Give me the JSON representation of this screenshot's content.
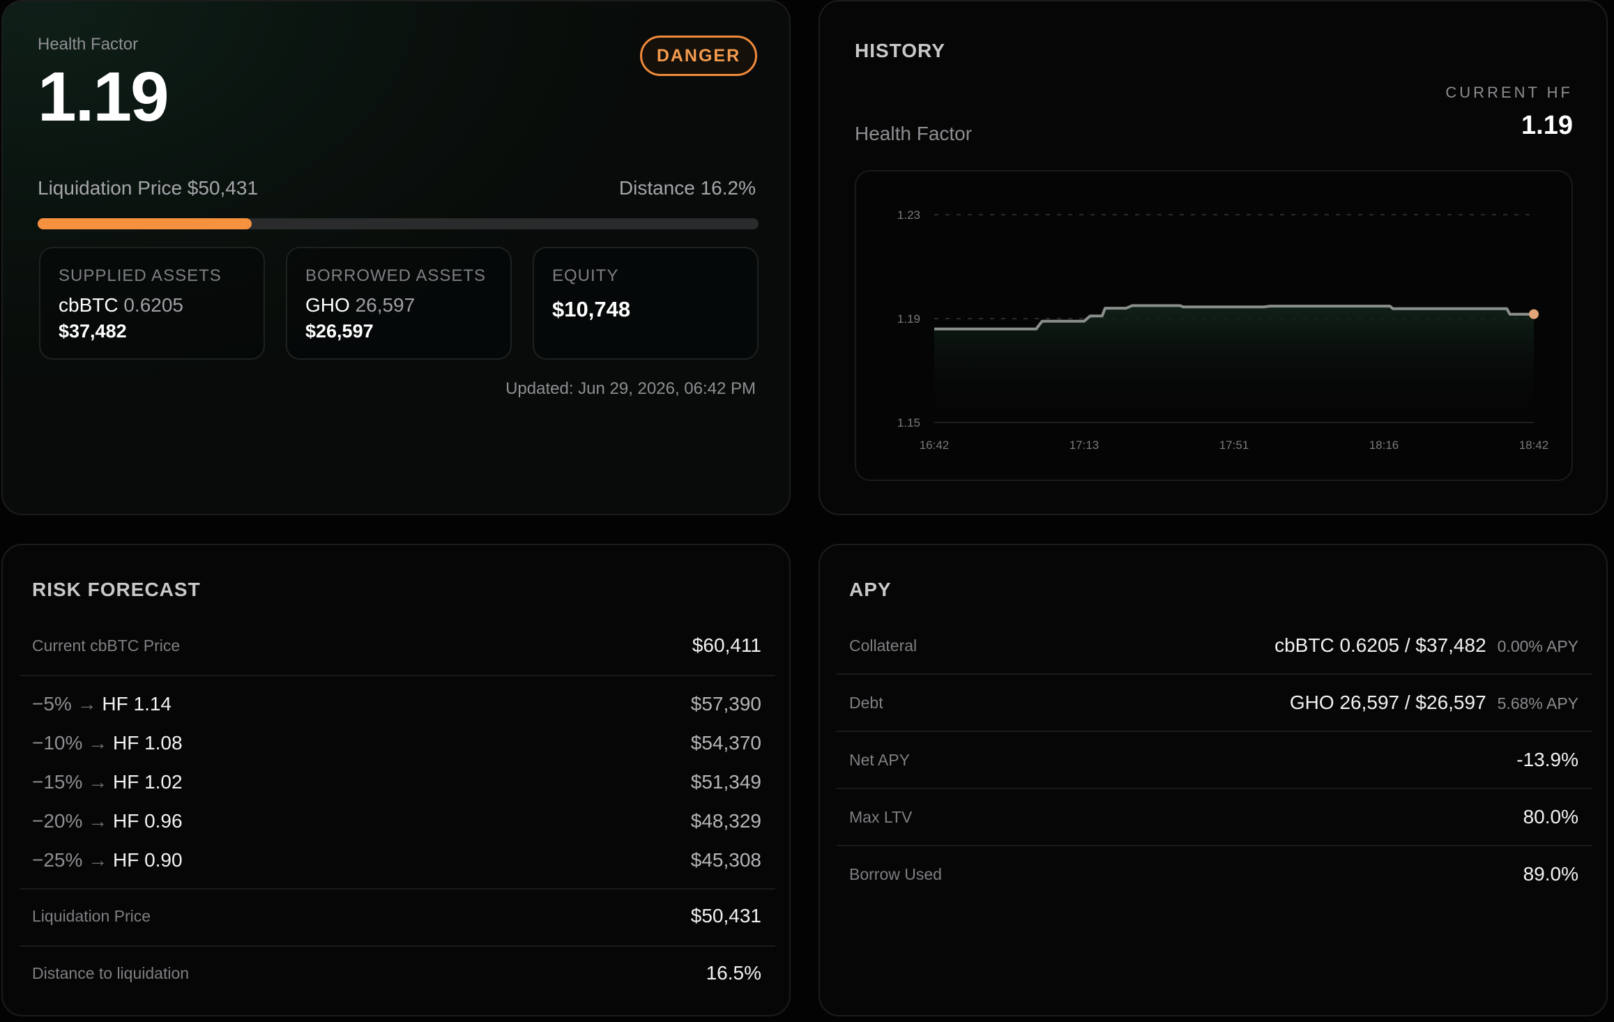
{
  "health": {
    "label": "Health Factor",
    "value": "1.19",
    "status": "DANGER",
    "liquidation_price_label": "Liquidation Price $50,431",
    "distance_label": "Distance 16.2%",
    "progress_fraction": 0.297,
    "supplied": {
      "title": "SUPPLIED ASSETS",
      "asset": "cbBTC",
      "amount": "0.6205",
      "value": "$37,482"
    },
    "borrowed": {
      "title": "BORROWED ASSETS",
      "asset": "GHO",
      "amount": "26,597",
      "value": "$26,597"
    },
    "equity": {
      "title": "EQUITY",
      "value": "$10,748"
    },
    "updated": "Updated: Jun 29, 2026, 06:42 PM",
    "accent_color": "#f5913f"
  },
  "history": {
    "title": "HISTORY",
    "current_label": "CURRENT HF",
    "current_value": "1.19",
    "subtitle": "Health Factor"
  },
  "chart_data": {
    "type": "line",
    "x_ticks": [
      "16:42",
      "17:13",
      "17:51",
      "18:16",
      "18:42"
    ],
    "y_ticks": [
      "1.23",
      "1.19",
      "1.15"
    ],
    "ylim": [
      1.15,
      1.23
    ],
    "series": [
      {
        "values": [
          [
            0.0,
            1.186
          ],
          [
            0.17,
            1.186
          ],
          [
            0.18,
            1.189
          ],
          [
            0.25,
            1.189
          ],
          [
            0.26,
            1.191
          ],
          [
            0.28,
            1.191
          ],
          [
            0.285,
            1.194
          ],
          [
            0.32,
            1.194
          ],
          [
            0.33,
            1.195
          ],
          [
            0.41,
            1.195
          ],
          [
            0.415,
            1.1945
          ],
          [
            0.55,
            1.1945
          ],
          [
            0.56,
            1.1948
          ],
          [
            0.76,
            1.1948
          ],
          [
            0.765,
            1.1938
          ],
          [
            0.955,
            1.1938
          ],
          [
            0.96,
            1.1917
          ],
          [
            1.0,
            1.1917
          ]
        ]
      }
    ],
    "line_color": "#8a8f8c",
    "end_marker_color": "#e3a47a",
    "grid": "dashed at 1.23 and 1.19"
  },
  "risk": {
    "title": "RISK FORECAST",
    "current_label": "Current cbBTC Price",
    "current_value": "$60,411",
    "scenarios": [
      {
        "pct": "−5%",
        "hf": "HF 1.14",
        "price": "$57,390"
      },
      {
        "pct": "−10%",
        "hf": "HF 1.08",
        "price": "$54,370"
      },
      {
        "pct": "−15%",
        "hf": "HF 1.02",
        "price": "$51,349"
      },
      {
        "pct": "−20%",
        "hf": "HF 0.96",
        "price": "$48,329"
      },
      {
        "pct": "−25%",
        "hf": "HF 0.90",
        "price": "$45,308"
      }
    ],
    "arrow": "→",
    "liq_label": "Liquidation Price",
    "liq_value": "$50,431",
    "dist_label": "Distance to liquidation",
    "dist_value": "16.5%"
  },
  "apy": {
    "title": "APY",
    "rows": [
      {
        "label": "Collateral",
        "value": "cbBTC 0.6205 / $37,482",
        "extra": "0.00% APY"
      },
      {
        "label": "Debt",
        "value": "GHO 26,597 / $26,597",
        "extra": "5.68% APY"
      },
      {
        "label": "Net APY",
        "value": "-13.9%",
        "extra": ""
      },
      {
        "label": "Max LTV",
        "value": "80.0%",
        "extra": ""
      },
      {
        "label": "Borrow Used",
        "value": "89.0%",
        "extra": ""
      }
    ]
  }
}
